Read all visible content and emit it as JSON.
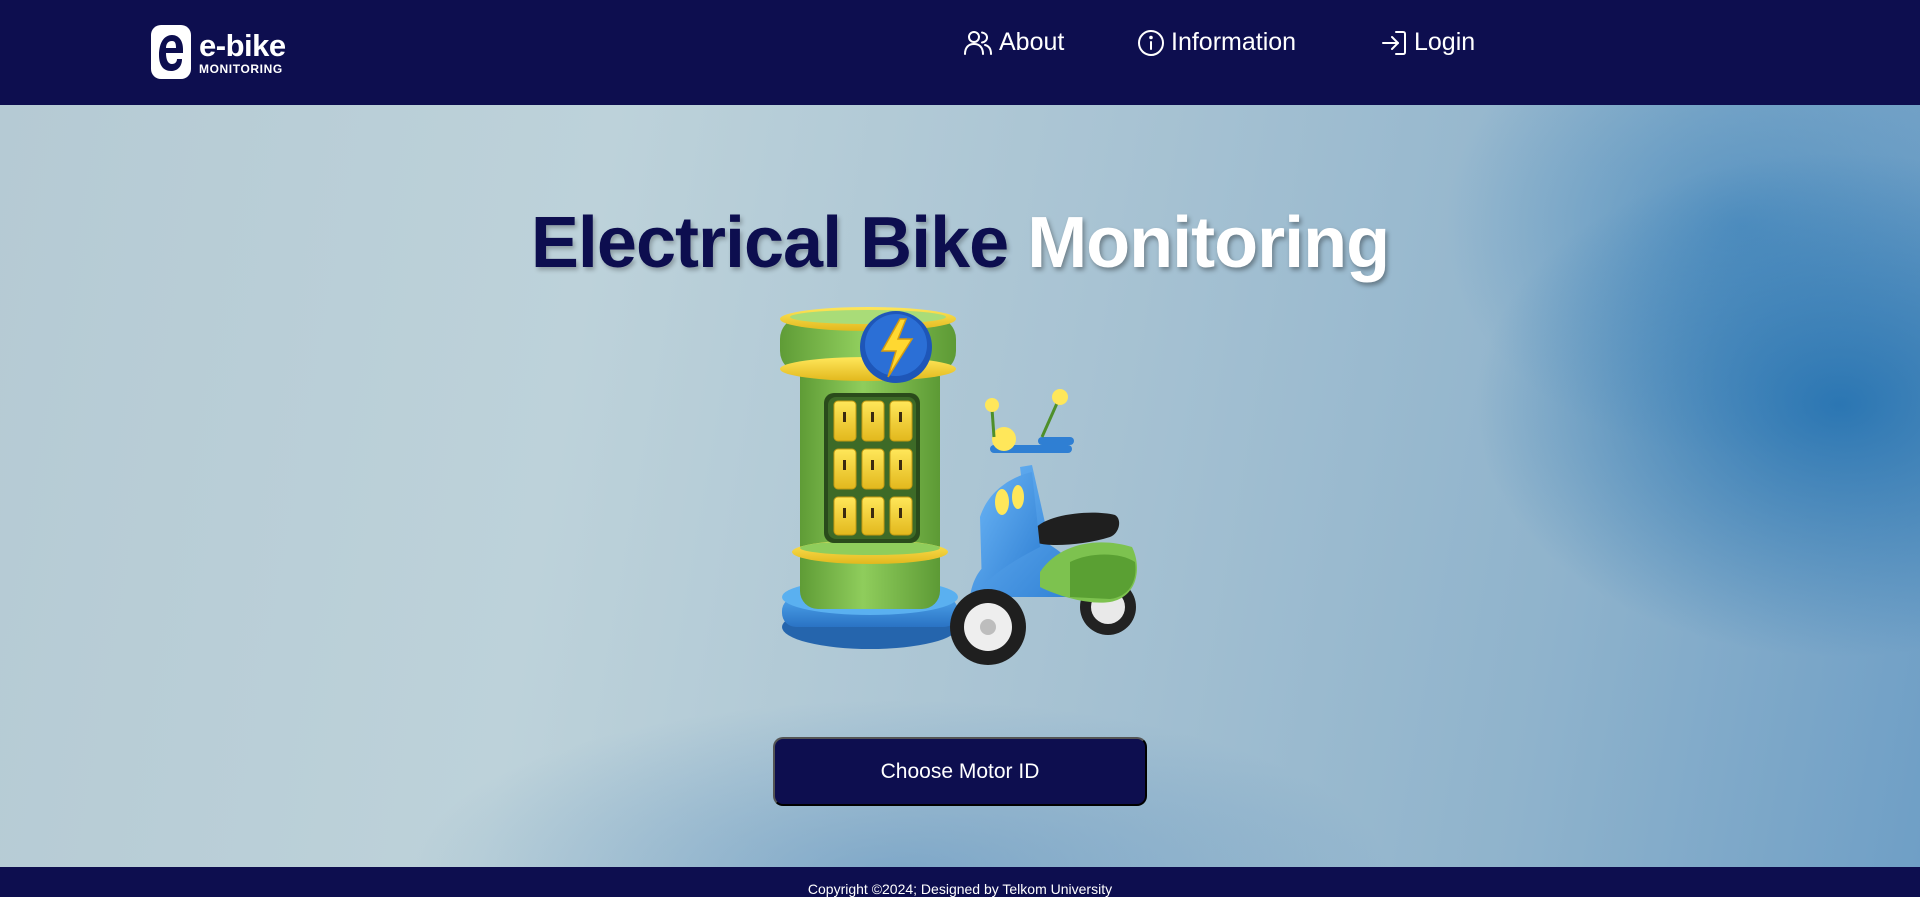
{
  "brand": {
    "logo_title": "e-bike",
    "logo_subtitle": "MONITORING"
  },
  "nav": {
    "items": [
      {
        "label": "About",
        "icon": "users-icon"
      },
      {
        "label": "Information",
        "icon": "info-circle-icon"
      },
      {
        "label": "Login",
        "icon": "login-arrow-icon"
      }
    ]
  },
  "hero": {
    "title_dark": "Electrical Bike",
    "title_light": "Monitoring",
    "illustration": "charging-station-scooter-illustration",
    "cta_label": "Choose Motor ID"
  },
  "footer": {
    "copyright": "Copyright ©2024; Designed by Telkom University"
  },
  "colors": {
    "navy": "#0d0e4f",
    "white": "#ffffff",
    "station_green": "#7fbf4d",
    "accent_yellow": "#f2d230",
    "scooter_blue": "#3d8fdd"
  }
}
